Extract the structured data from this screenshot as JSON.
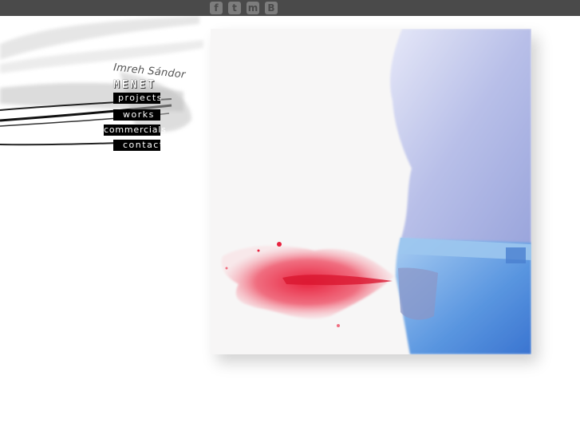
{
  "social": {
    "items": [
      {
        "name": "facebook",
        "glyph": "f"
      },
      {
        "name": "twitter",
        "glyph": "t"
      },
      {
        "name": "myspace",
        "glyph": "m"
      },
      {
        "name": "blogger",
        "glyph": "B"
      }
    ]
  },
  "header": {
    "artist_name": "Imreh Sándor",
    "logo": "MENET"
  },
  "nav": {
    "projects": "projects",
    "works": "works",
    "commercials": "commercials",
    "contact": "contact"
  },
  "colors": {
    "topbar": "#4a4a4a",
    "shirt": "#b6bde6",
    "jeans": "#5a96e0",
    "paint": "#e8304a"
  }
}
